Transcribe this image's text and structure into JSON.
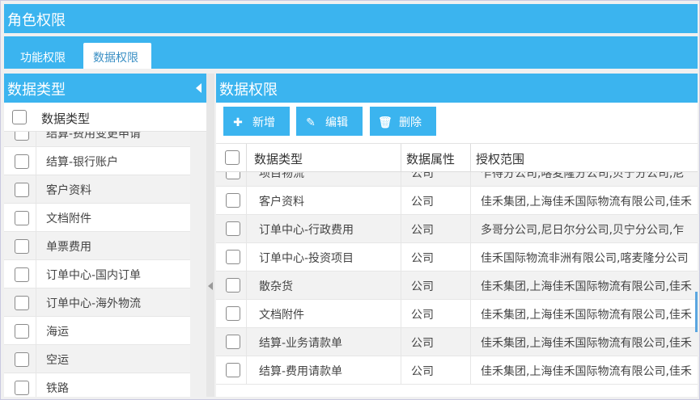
{
  "window": {
    "title": "角色权限"
  },
  "tabs": [
    {
      "label": "功能权限",
      "active": false
    },
    {
      "label": "数据权限",
      "active": true
    }
  ],
  "left_panel": {
    "title": "数据类型",
    "header_label": "数据类型",
    "items": [
      "结算-费用变更申请",
      "结算-银行账户",
      "客户资料",
      "文档附件",
      "单票费用",
      "订单中心-国内订单",
      "订单中心-海外物流",
      "海运",
      "空运",
      "铁路"
    ]
  },
  "right_panel": {
    "title": "数据权限",
    "toolbar": {
      "add_label": "新增",
      "edit_label": "编辑",
      "delete_label": "删除"
    },
    "columns": [
      "数据类型",
      "数据属性",
      "授权范围"
    ],
    "rows": [
      {
        "type": "项目物流",
        "attr": "公司",
        "scope": "乍得分公司,喀麦隆分公司,贝宁分公司,尼"
      },
      {
        "type": "客户资料",
        "attr": "公司",
        "scope": "佳禾集团,上海佳禾国际物流有限公司,佳禾"
      },
      {
        "type": "订单中心-行政费用",
        "attr": "公司",
        "scope": "多哥分公司,尼日尔分公司,贝宁分公司,乍"
      },
      {
        "type": "订单中心-投资项目",
        "attr": "公司",
        "scope": "佳禾国际物流非洲有限公司,喀麦隆分公司"
      },
      {
        "type": "散杂货",
        "attr": "公司",
        "scope": "佳禾集团,上海佳禾国际物流有限公司,佳禾"
      },
      {
        "type": "文档附件",
        "attr": "公司",
        "scope": "佳禾集团,上海佳禾国际物流有限公司,佳禾"
      },
      {
        "type": "结算-业务请款单",
        "attr": "公司",
        "scope": "佳禾集团,上海佳禾国际物流有限公司,佳禾"
      },
      {
        "type": "结算-费用请款单",
        "attr": "公司",
        "scope": "佳禾集团,上海佳禾国际物流有限公司,佳禾"
      }
    ]
  },
  "colors": {
    "accent": "#3bb4ef",
    "row_alt": "#f2f2f2"
  }
}
